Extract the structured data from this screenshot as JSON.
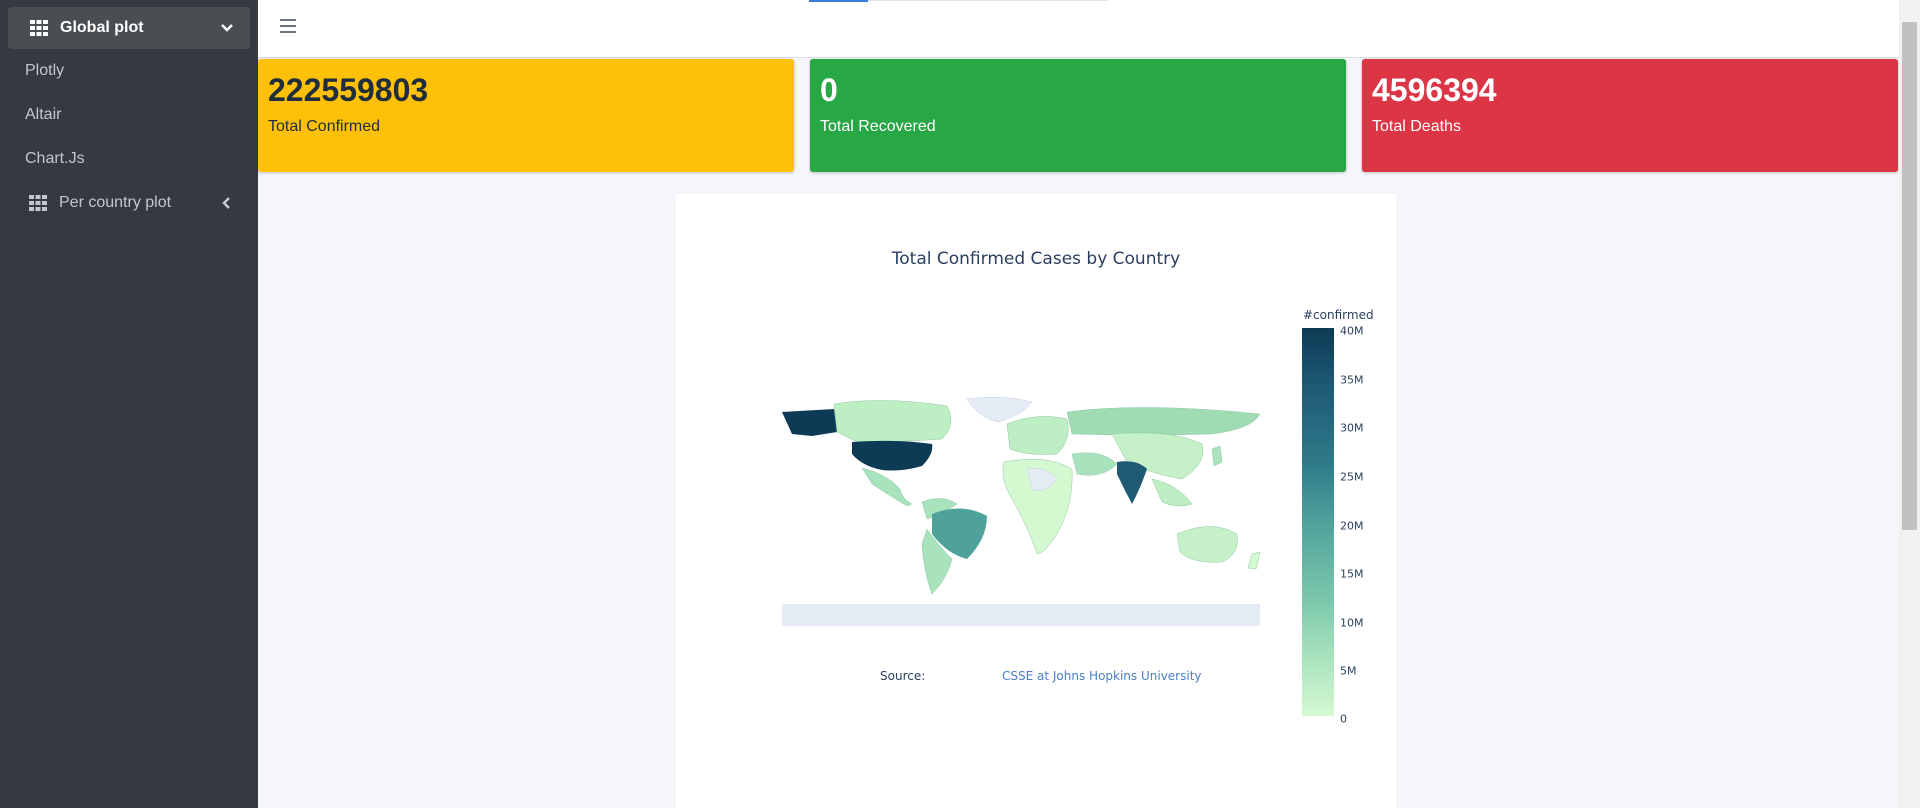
{
  "sidebar": {
    "items": [
      {
        "label": "Global plot",
        "icon": "grid-icon",
        "chevron": "chevron-down-icon"
      },
      {
        "label": "Plotly"
      },
      {
        "label": "Altair"
      },
      {
        "label": "Chart.Js"
      },
      {
        "label": "Per country plot",
        "icon": "grid-icon",
        "chevron": "chevron-left-icon"
      }
    ]
  },
  "stats": {
    "confirmed": {
      "value": "222559803",
      "label": "Total Confirmed",
      "color": "#ffc107"
    },
    "recovered": {
      "value": "0",
      "label": "Total Recovered",
      "color": "#28a745"
    },
    "deaths": {
      "value": "4596394",
      "label": "Total Deaths",
      "color": "#dc3545"
    }
  },
  "chart": {
    "title": "Total Confirmed Cases by Country",
    "source_label": "Source:",
    "source_link": "CSSE at Johns Hopkins University",
    "colorbar_title": "#confirmed",
    "colorbar_ticks": [
      "40M",
      "35M",
      "30M",
      "25M",
      "20M",
      "15M",
      "10M",
      "5M",
      "0"
    ]
  },
  "chart_data": {
    "type": "heatmap",
    "title": "Total Confirmed Cases by Country",
    "colorbar": {
      "title": "#confirmed",
      "range": [
        0,
        40000000
      ],
      "ticks": [
        "0",
        "5M",
        "10M",
        "15M",
        "20M",
        "25M",
        "30M",
        "35M",
        "40M"
      ]
    },
    "colorscale": [
      "#d4f9d1",
      "#a9e3bd",
      "#7bc7ac",
      "#4fa19b",
      "#2f7a8a",
      "#1e5a73",
      "#0d3b55"
    ]
  },
  "colors": {
    "sidebar_bg": "#343a40",
    "sidebar_active": "#494e53",
    "page_bg": "#f4f6f9"
  }
}
